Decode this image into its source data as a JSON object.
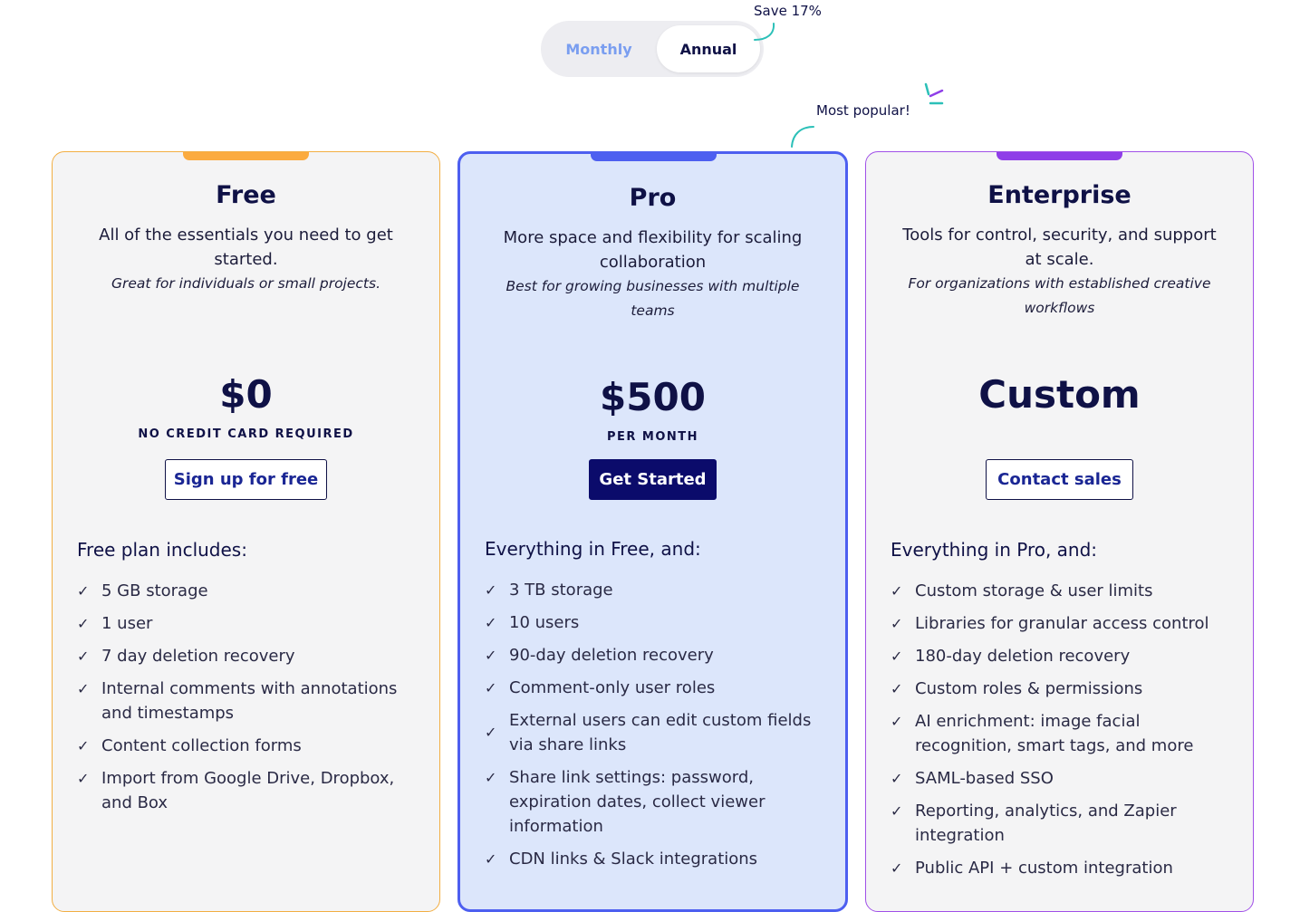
{
  "billing_toggle": {
    "monthly_label": "Monthly",
    "annual_label": "Annual",
    "selected": "Annual"
  },
  "save_label": "Save 17%",
  "popular_label": "Most popular!",
  "plans": [
    {
      "name": "Free",
      "accent_color": "#fbab3f",
      "description": "All of the essentials you need to get started.",
      "subtext": "Great for individuals or small projects.",
      "price": "$0",
      "price_note": "NO CREDIT CARD REQUIRED",
      "cta_label": "Sign up for free",
      "features_title": "Free plan includes:",
      "features": [
        "5 GB storage",
        "1 user",
        "7 day deletion recovery",
        "Internal comments with annotations and timestamps",
        "Content collection forms",
        "Import from Google Drive, Dropbox, and Box"
      ]
    },
    {
      "name": "Pro",
      "accent_color": "#4d5ff0",
      "description": "More space and flexibility for scaling collaboration",
      "subtext": "Best for growing businesses with multiple teams",
      "price": "$500",
      "price_note": "PER MONTH",
      "cta_label": "Get Started",
      "features_title": "Everything in Free, and:",
      "features": [
        "3 TB storage",
        "10 users",
        "90-day deletion recovery",
        "Comment-only user roles",
        "External users can edit custom fields via share links",
        "Share link settings: password, expiration dates, collect viewer information",
        "CDN links & Slack integrations"
      ]
    },
    {
      "name": "Enterprise",
      "accent_color": "#8f3ee8",
      "description": "Tools for control, security, and support at scale.",
      "subtext": "For organizations with established creative workflows",
      "price": "Custom",
      "price_note": "",
      "cta_label": "Contact sales",
      "features_title": "Everything in Pro, and:",
      "features": [
        "Custom storage & user limits",
        "Libraries for granular access control",
        "180-day deletion recovery",
        "Custom roles & permissions",
        "AI enrichment: image facial recognition, smart tags, and more",
        "SAML-based SSO",
        "Reporting, analytics, and Zapier integration",
        "Public API + custom integration"
      ]
    }
  ]
}
